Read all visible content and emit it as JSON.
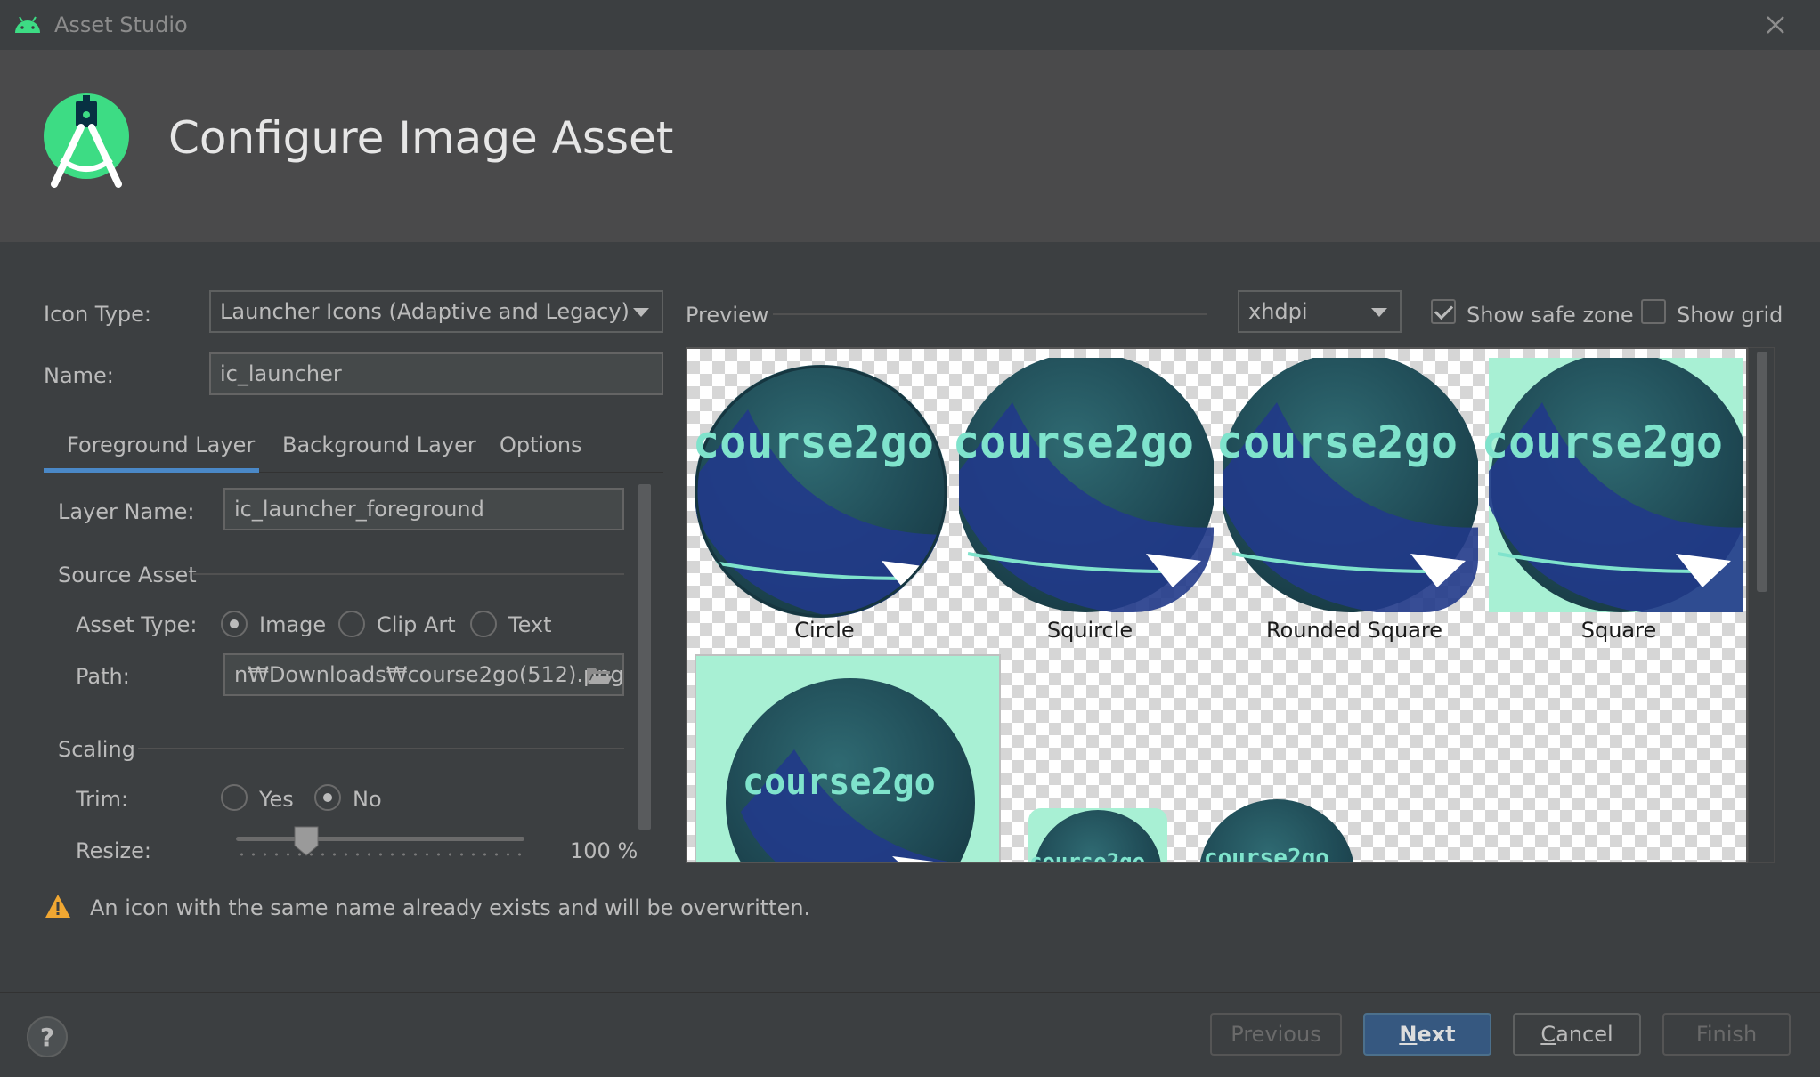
{
  "window": {
    "title": "Asset Studio"
  },
  "header": {
    "title": "Configure Image Asset"
  },
  "form": {
    "icon_type_label": "Icon Type:",
    "icon_type_value": "Launcher Icons (Adaptive and Legacy)",
    "name_label": "Name:",
    "name_value": "ic_launcher"
  },
  "tabs": [
    {
      "label": "Foreground Layer",
      "selected": true
    },
    {
      "label": "Background Layer",
      "selected": false
    },
    {
      "label": "Options",
      "selected": false
    }
  ],
  "layer": {
    "layer_name_label": "Layer Name:",
    "layer_name_value": "ic_launcher_foreground",
    "source_asset_heading": "Source Asset",
    "asset_type_label": "Asset Type:",
    "asset_type_options": [
      "Image",
      "Clip Art",
      "Text"
    ],
    "asset_type_selected": "Image",
    "path_label": "Path:",
    "path_value": "n₩Downloads₩course2go(512).png",
    "scaling_heading": "Scaling",
    "trim_label": "Trim:",
    "trim_options": [
      "Yes",
      "No"
    ],
    "trim_selected": "No",
    "resize_label": "Resize:",
    "resize_value": "100 %",
    "resize_level": 0.2
  },
  "preview": {
    "label": "Preview",
    "density_value": "xhdpi",
    "show_safe_zone_label": "Show safe zone",
    "show_safe_zone_checked": true,
    "show_grid_label": "Show grid",
    "show_grid_checked": false,
    "icon_text": "course2go",
    "shapes": [
      "Circle",
      "Squircle",
      "Rounded Square",
      "Square"
    ]
  },
  "warning": {
    "text": "An icon with the same name already exists and will be overwritten."
  },
  "buttons": {
    "help": "?",
    "previous": "Previous",
    "next_mnemonic": "N",
    "next_rest": "ext",
    "cancel_mnemonic": "C",
    "cancel_rest": "ancel",
    "finish": "Finish"
  },
  "colors": {
    "accent": "#4a88c7",
    "primary_button": "#365880",
    "icon_text": "#7fe3cc",
    "icon_background_mint": "#a8f0d4",
    "icon_dark_teal": "#1f4a55",
    "icon_navy": "#213a8a",
    "warning": "#f0a732"
  }
}
